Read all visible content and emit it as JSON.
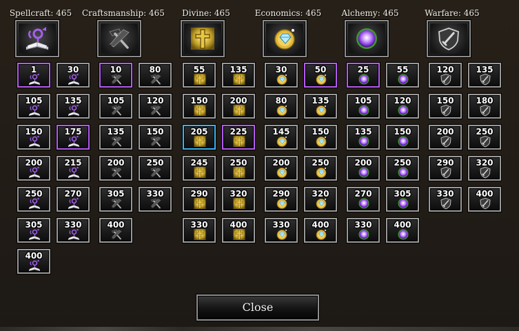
{
  "columns": [
    {
      "key": "spellcraft",
      "title": "Spellcraft: 465",
      "icon": "spellbook-icon",
      "tile_icon": "spellbook-icon",
      "values": [
        "1",
        "30",
        "105",
        "135",
        "150",
        "175",
        "200",
        "215",
        "250",
        "270",
        "305",
        "330",
        "400"
      ],
      "selected": {
        "0": "purple",
        "5": "purple"
      }
    },
    {
      "key": "craftsmanship",
      "title": "Craftsmanship: 465",
      "icon": "hammer-saw-icon",
      "tile_icon": "hammer-saw-icon",
      "values": [
        "10",
        "80",
        "105",
        "120",
        "135",
        "150",
        "200",
        "250",
        "305",
        "330",
        "400"
      ],
      "selected": {
        "0": "purple"
      }
    },
    {
      "key": "divine",
      "title": "Divine: 465",
      "icon": "cross-icon",
      "tile_icon": "cross-icon",
      "values": [
        "55",
        "135",
        "150",
        "200",
        "205",
        "225",
        "245",
        "250",
        "290",
        "320",
        "330",
        "400"
      ],
      "selected": {
        "4": "blue",
        "5": "purple"
      }
    },
    {
      "key": "economics",
      "title": "Economics: 465",
      "icon": "gem-gold-icon",
      "tile_icon": "gem-gold-icon",
      "values": [
        "30",
        "50",
        "80",
        "135",
        "145",
        "150",
        "200",
        "250",
        "290",
        "320",
        "330",
        "400"
      ],
      "selected": {
        "1": "purple"
      }
    },
    {
      "key": "alchemy",
      "title": "Alchemy: 465",
      "icon": "orb-icon",
      "tile_icon": "orb-icon",
      "values": [
        "25",
        "55",
        "105",
        "120",
        "135",
        "150",
        "200",
        "250",
        "270",
        "305",
        "330",
        "400"
      ],
      "selected": {
        "0": "purple"
      }
    },
    {
      "key": "warfare",
      "title": "Warfare: 465",
      "icon": "shield-sword-icon",
      "tile_icon": "shield-sword-icon",
      "values": [
        "120",
        "135",
        "150",
        "180",
        "200",
        "250",
        "290",
        "320",
        "330",
        "400"
      ],
      "selected": {}
    }
  ],
  "close_label": "Close",
  "colors": {
    "purple_select": "#b55cf2",
    "blue_select": "#3cb3f5",
    "background": "#221d19"
  }
}
